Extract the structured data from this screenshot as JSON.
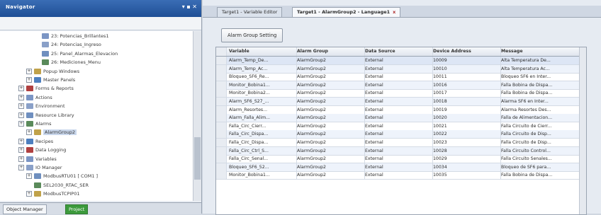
{
  "left_panel": {
    "title": "Navigator",
    "tree": [
      {
        "label": "23: Potencias_Brillantes1",
        "indent": 5
      },
      {
        "label": "24: Potencias_Ingreso",
        "indent": 5
      },
      {
        "label": "25: Panel_Alarmas_Elevacion",
        "indent": 5
      },
      {
        "label": "26: Mediciones_Menu",
        "indent": 5
      },
      {
        "label": "Popup Windows",
        "indent": 3
      },
      {
        "label": "Master Panels",
        "indent": 3
      },
      {
        "label": "Forms & Reports",
        "indent": 2
      },
      {
        "label": "Actions",
        "indent": 2
      },
      {
        "label": "Environment",
        "indent": 2
      },
      {
        "label": "Resource Library",
        "indent": 2
      },
      {
        "label": "Alarms",
        "indent": 2
      },
      {
        "label": "AlarmGroup2",
        "indent": 3,
        "selected": true
      },
      {
        "label": "Recipes",
        "indent": 2
      },
      {
        "label": "Data Logging",
        "indent": 2
      },
      {
        "label": "Variables",
        "indent": 2
      },
      {
        "label": "IO Manager",
        "indent": 2
      },
      {
        "label": "ModbusRTU01 [ COM1 ]",
        "indent": 3
      },
      {
        "label": "SEL2030_RTAC_SER",
        "indent": 4
      },
      {
        "label": "ModbusTCPIP01",
        "indent": 3
      }
    ],
    "tabs": [
      "Object Manager",
      "Project"
    ]
  },
  "editor": {
    "tabs": [
      {
        "label": "Target1 - Variable Editor"
      },
      {
        "label": "Target1 - AlarmGroup2 - Language1",
        "close": "x"
      }
    ],
    "group_button": "Alarm Group Setting",
    "columns": [
      "Variable",
      "Alarm Group",
      "Data Source",
      "Device Address",
      "Message"
    ],
    "rows": [
      [
        "Alarm_Temp_De...",
        "AlarmGroup2",
        "External",
        "10009",
        "Alta Temperatura De..."
      ],
      [
        "Alarm_Temp_Ac...",
        "AlarmGroup2",
        "External",
        "10010",
        "Alta Temperatura Ac..."
      ],
      [
        "Bloqueo_SF6_Re...",
        "AlarmGroup2",
        "External",
        "10011",
        "Bloqueo SF6 en Inter..."
      ],
      [
        "Monitor_Bobina1...",
        "AlarmGroup2",
        "External",
        "10016",
        "Falla Bobina de Dispa..."
      ],
      [
        "Monitor_Bobina2...",
        "AlarmGroup2",
        "External",
        "10017",
        "Falla Bobina de Dispa..."
      ],
      [
        "Alarm_SF6_S27_...",
        "AlarmGroup2",
        "External",
        "10018",
        "Alarma SF6 en Inter..."
      ],
      [
        "Alarm_Resortes...",
        "AlarmGroup2",
        "External",
        "10019",
        "Alarma Resortes Des..."
      ],
      [
        "Alarm_Falla_Alim...",
        "AlarmGroup2",
        "External",
        "10020",
        "Falla de Alimentacion..."
      ],
      [
        "Falla_Circ_Cierr...",
        "AlarmGroup2",
        "External",
        "10021",
        "Falla Circuito de Cierr..."
      ],
      [
        "Falla_Circ_Dispa...",
        "AlarmGroup2",
        "External",
        "10022",
        "Falla Circuito de Disp..."
      ],
      [
        "Falla_Circ_Dispa...",
        "AlarmGroup2",
        "External",
        "10023",
        "Falla Circuito de Disp..."
      ],
      [
        "Falla_Circ_Ctrl_S...",
        "AlarmGroup2",
        "External",
        "10028",
        "Falla Circuito Control..."
      ],
      [
        "Falla_Circ_Senal...",
        "AlarmGroup2",
        "External",
        "10029",
        "Falla Circuito Senales..."
      ],
      [
        "Bloqueo_SF6_52...",
        "AlarmGroup2",
        "External",
        "10034",
        "Bloqueo de SF6 para..."
      ],
      [
        "Monitor_Bobina1...",
        "AlarmGroup2",
        "External",
        "10035",
        "Falla Bobina de Dispa..."
      ]
    ]
  }
}
